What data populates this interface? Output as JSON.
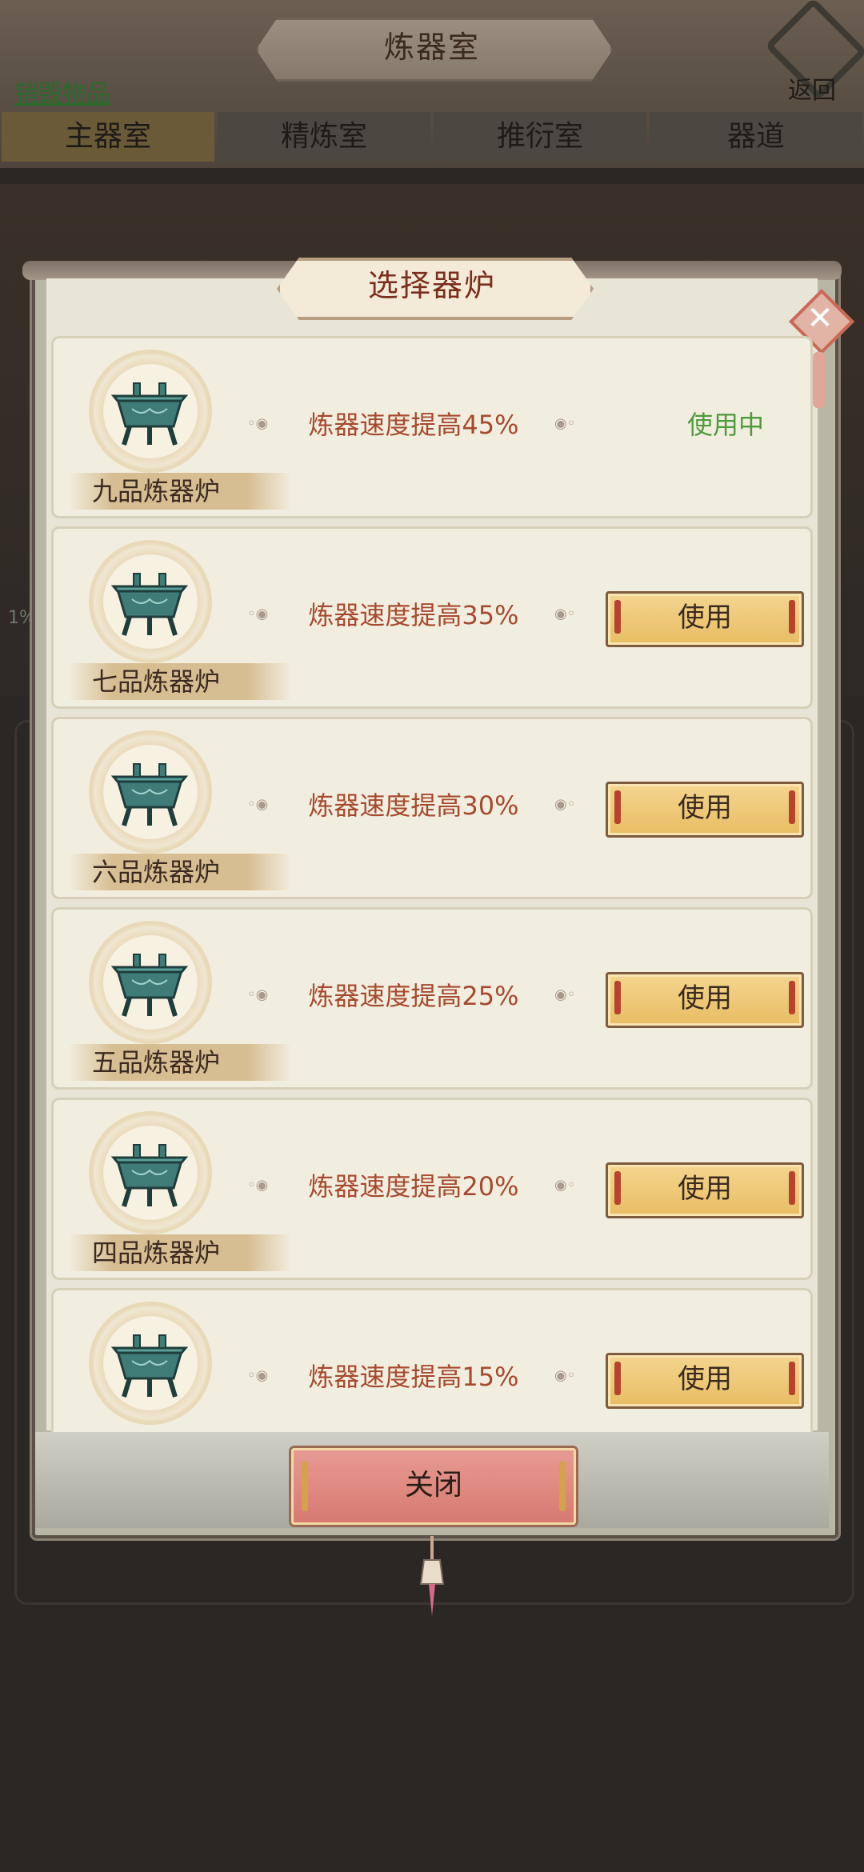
{
  "header": {
    "title": "炼器室",
    "back_label": "返回",
    "destroy_link": "销毁物品"
  },
  "tabs": [
    {
      "label": "主器室",
      "active": true
    },
    {
      "label": "精炼室",
      "active": false
    },
    {
      "label": "推衍室",
      "active": false
    },
    {
      "label": "器道",
      "active": false
    }
  ],
  "background": {
    "side_text": "1%"
  },
  "modal": {
    "title": "选择器炉",
    "close_label": "关闭",
    "items": [
      {
        "name": "九品炼器炉",
        "effect": "炼器速度提高45%",
        "status": "使用中",
        "in_use": true
      },
      {
        "name": "七品炼器炉",
        "effect": "炼器速度提高35%",
        "button": "使用",
        "in_use": false
      },
      {
        "name": "六品炼器炉",
        "effect": "炼器速度提高30%",
        "button": "使用",
        "in_use": false
      },
      {
        "name": "五品炼器炉",
        "effect": "炼器速度提高25%",
        "button": "使用",
        "in_use": false
      },
      {
        "name": "四品炼器炉",
        "effect": "炼器速度提高20%",
        "button": "使用",
        "in_use": false
      },
      {
        "name": "",
        "effect": "炼器速度提高15%",
        "button": "使用",
        "in_use": false
      }
    ]
  },
  "colors": {
    "effect_text": "#a64a2f",
    "active_status": "#4f9a3c",
    "use_button": "#f0cd7c",
    "close_button": "#e0897f"
  }
}
